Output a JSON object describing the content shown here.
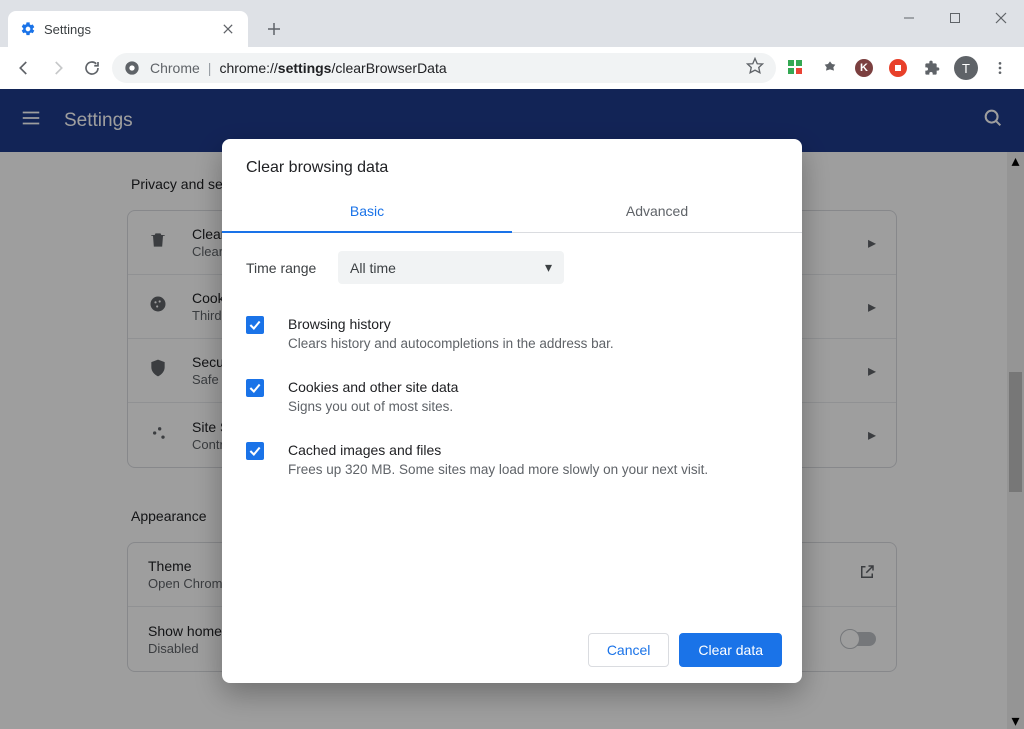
{
  "tab": {
    "title": "Settings"
  },
  "omnibox": {
    "prefix": "Chrome",
    "url": "chrome://settings/clearBrowserData"
  },
  "header": {
    "title": "Settings"
  },
  "sections": {
    "privacy": {
      "heading": "Privacy and security",
      "rows": [
        {
          "title": "Clear browsing data",
          "sub": "Clear history, cookies, cache, and more"
        },
        {
          "title": "Cookies and other site data",
          "sub": "Third-party cookies are blocked in Incognito mode"
        },
        {
          "title": "Security",
          "sub": "Safe Browsing (protection from dangerous sites) and other security settings"
        },
        {
          "title": "Site Settings",
          "sub": "Controls what information sites can use and show"
        }
      ]
    },
    "appearance": {
      "heading": "Appearance",
      "rows": [
        {
          "title": "Theme",
          "sub": "Open Chrome Web Store"
        },
        {
          "title": "Show home button",
          "sub": "Disabled"
        }
      ]
    }
  },
  "modal": {
    "title": "Clear browsing data",
    "tabs": {
      "basic": "Basic",
      "advanced": "Advanced"
    },
    "timeRange": {
      "label": "Time range",
      "value": "All time"
    },
    "options": [
      {
        "title": "Browsing history",
        "sub": "Clears history and autocompletions in the address bar."
      },
      {
        "title": "Cookies and other site data",
        "sub": "Signs you out of most sites."
      },
      {
        "title": "Cached images and files",
        "sub": "Frees up 320 MB. Some sites may load more slowly on your next visit."
      }
    ],
    "buttons": {
      "cancel": "Cancel",
      "confirm": "Clear data"
    }
  },
  "avatar": {
    "initial": "T"
  }
}
